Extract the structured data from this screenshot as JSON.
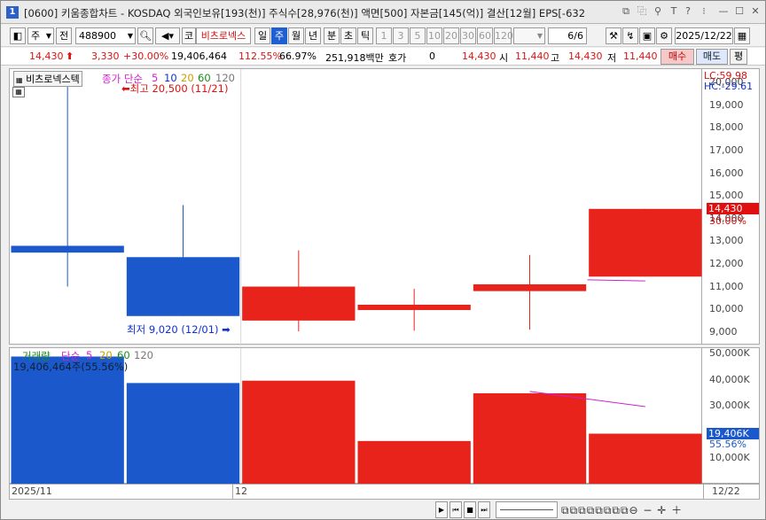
{
  "titlebar": {
    "number": "1",
    "title": "[0600] 키움종합차트 - KOSDAQ 외국인보유[193(천)] 주식수[28,976(천)] 액면[500] 자본금[145(억)] 결산[12월] EPS[-632"
  },
  "toolbar": {
    "market": "주",
    "prev": "전",
    "code": "488900",
    "stock_name": "비츠로넥스",
    "code_prefix": "코",
    "periods": [
      "일",
      "주",
      "월",
      "년"
    ],
    "active_period": "주",
    "sub_periods": [
      "분",
      "초",
      "틱"
    ],
    "intervals": [
      "1",
      "3",
      "5",
      "10",
      "20",
      "30",
      "60",
      "120"
    ],
    "page": "6/6",
    "date": "2025/12/22"
  },
  "quote": {
    "price": "14,430",
    "change": "3,330",
    "change_pct": "+30.00%",
    "volume": "19,406,464",
    "vol_ratio": "112.55%",
    "turnover": "66.97%",
    "amount": "251,918백만",
    "hoga_label": "호가",
    "hoga_value": "0",
    "price2": "14,430",
    "open_label": "시",
    "open": "11,440",
    "high_label": "고",
    "high": "14,430",
    "low_label": "저",
    "low": "11,440",
    "buy": "매수",
    "sell": "매도",
    "eval": "평"
  },
  "price_pane": {
    "name_tag": "비츠로넥스텍",
    "ma_label": "종가 단순",
    "ma_periods": [
      "5",
      "10",
      "20",
      "60",
      "120"
    ],
    "max_label": "최고 20,500 (11/21)",
    "min_label": "최저 9,020 (12/01)",
    "lc": "LC:59.98",
    "hc": "HC:-29.61",
    "current_tag": "14,430",
    "current_pct": "30.00%",
    "y_ticks": [
      "20,000",
      "19,000",
      "18,000",
      "17,000",
      "16,000",
      "15,000",
      "14,000",
      "13,000",
      "12,000",
      "11,000",
      "10,000",
      "9,000"
    ]
  },
  "volume_pane": {
    "label": "거래량",
    "ma_label": "단순",
    "ma_periods": [
      "5",
      "20",
      "60",
      "120"
    ],
    "value_label": "19,406,464주(55.56%)",
    "current_tag": "19,406K",
    "current_pct": "55.56%",
    "y_ticks": [
      "50,000K",
      "40,000K",
      "30,000K",
      "20,000K",
      "10,000K"
    ]
  },
  "dates": {
    "left": "2025/11",
    "mid": "12",
    "right": "12/22"
  },
  "colors": {
    "up": "#e8231b",
    "down": "#1a58cc",
    "ma5": "#d020d0"
  },
  "chart_data": {
    "type": "candlestick",
    "candles": [
      {
        "open": 12800,
        "high": 20500,
        "low": 11000,
        "close": 12500
      },
      {
        "open": 12300,
        "high": 14600,
        "low": 9700,
        "close": 9700
      },
      {
        "open": 9500,
        "high": 12600,
        "low": 9020,
        "close": 11000
      },
      {
        "open": 10000,
        "high": 10900,
        "low": 9050,
        "close": 10200
      },
      {
        "open": 10800,
        "high": 12400,
        "low": 9100,
        "close": 11100
      },
      {
        "open": 11440,
        "high": 14430,
        "low": 11440,
        "close": 14430
      }
    ],
    "volume": [
      48800000,
      38700000,
      39600000,
      16600000,
      34800000,
      19406464
    ],
    "ma5_price": [
      11300,
      11250
    ],
    "ma5_volume": [
      35500000,
      29700000
    ],
    "price_range": [
      8400,
      20600
    ],
    "volume_range": [
      0,
      52000000
    ]
  }
}
